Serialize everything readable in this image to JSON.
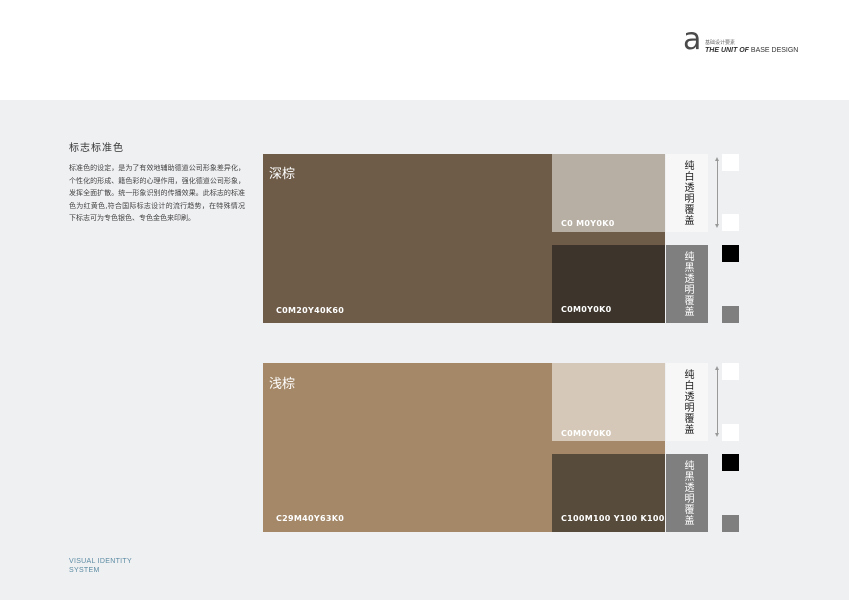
{
  "logo": {
    "letter": "a",
    "cn": "基础设计要素",
    "en_bold": "THE UNIT OF",
    "en_rest": " BASE DESIGN"
  },
  "section_title": "标志标准色",
  "description": "标准色的设定，是为了有效地辅助德道公司形象差异化，个性化的形成、籍色彩的心理作用，强化德道公司形象，发挥全面扩散。统一形象识别的传播效果。此标志的标准色为红黄色,符合国际标志设计的流行趋势，在特殊情况下标志可为专色银色、专色金色来印刷。",
  "dark_group": {
    "name": "深棕",
    "main_code": "C0M20Y40K60",
    "main_color": "#6e5c49",
    "white_overlay_code": "C0 M0Y0K0",
    "white_overlay_color": "#b7afa4",
    "black_overlay_code": "C0M0Y0K0",
    "black_overlay_color": "#3d352b",
    "white_label": "纯白透明覆盖",
    "black_label": "纯黑透明覆盖"
  },
  "light_group": {
    "name": "浅棕",
    "main_code": "C29M40Y63K0",
    "main_color": "#a48868",
    "white_overlay_code": "C0M0Y0K0",
    "white_overlay_color": "#d5c8b8",
    "black_overlay_code": "C100M100 Y100 K100",
    "black_overlay_color": "#574b3b",
    "white_label": "纯白透明覆盖",
    "black_label": "纯黑透明覆盖"
  },
  "swatch_colors": {
    "white": "#ffffff",
    "black": "#000000",
    "gray": "#7f7f7f",
    "white_panel": "#f7f7f7",
    "gray_panel": "#7f7f7f"
  },
  "footer": {
    "line1": "VISUAL IDENTITY",
    "line2": "SYSTEM"
  }
}
